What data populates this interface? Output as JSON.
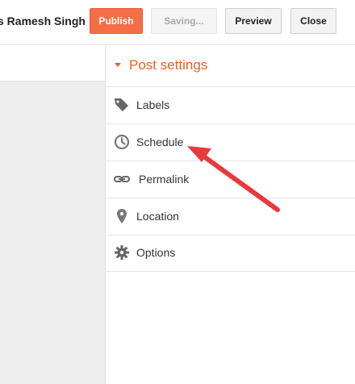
{
  "header": {
    "author": "s Ramesh Singh",
    "buttons": {
      "publish": "Publish",
      "saving": "Saving...",
      "preview": "Preview",
      "close": "Close"
    }
  },
  "sidebar": {
    "title": "Post settings",
    "items": [
      {
        "label": "Labels",
        "icon": "tag-icon"
      },
      {
        "label": "Schedule",
        "icon": "clock-icon"
      },
      {
        "label": "Permalink",
        "icon": "link-icon"
      },
      {
        "label": "Location",
        "icon": "location-pin-icon"
      },
      {
        "label": "Options",
        "icon": "gear-icon"
      }
    ]
  },
  "colors": {
    "accent": "#e8621f",
    "publish_button": "#f56e45",
    "annotation_arrow": "#e8393c"
  }
}
